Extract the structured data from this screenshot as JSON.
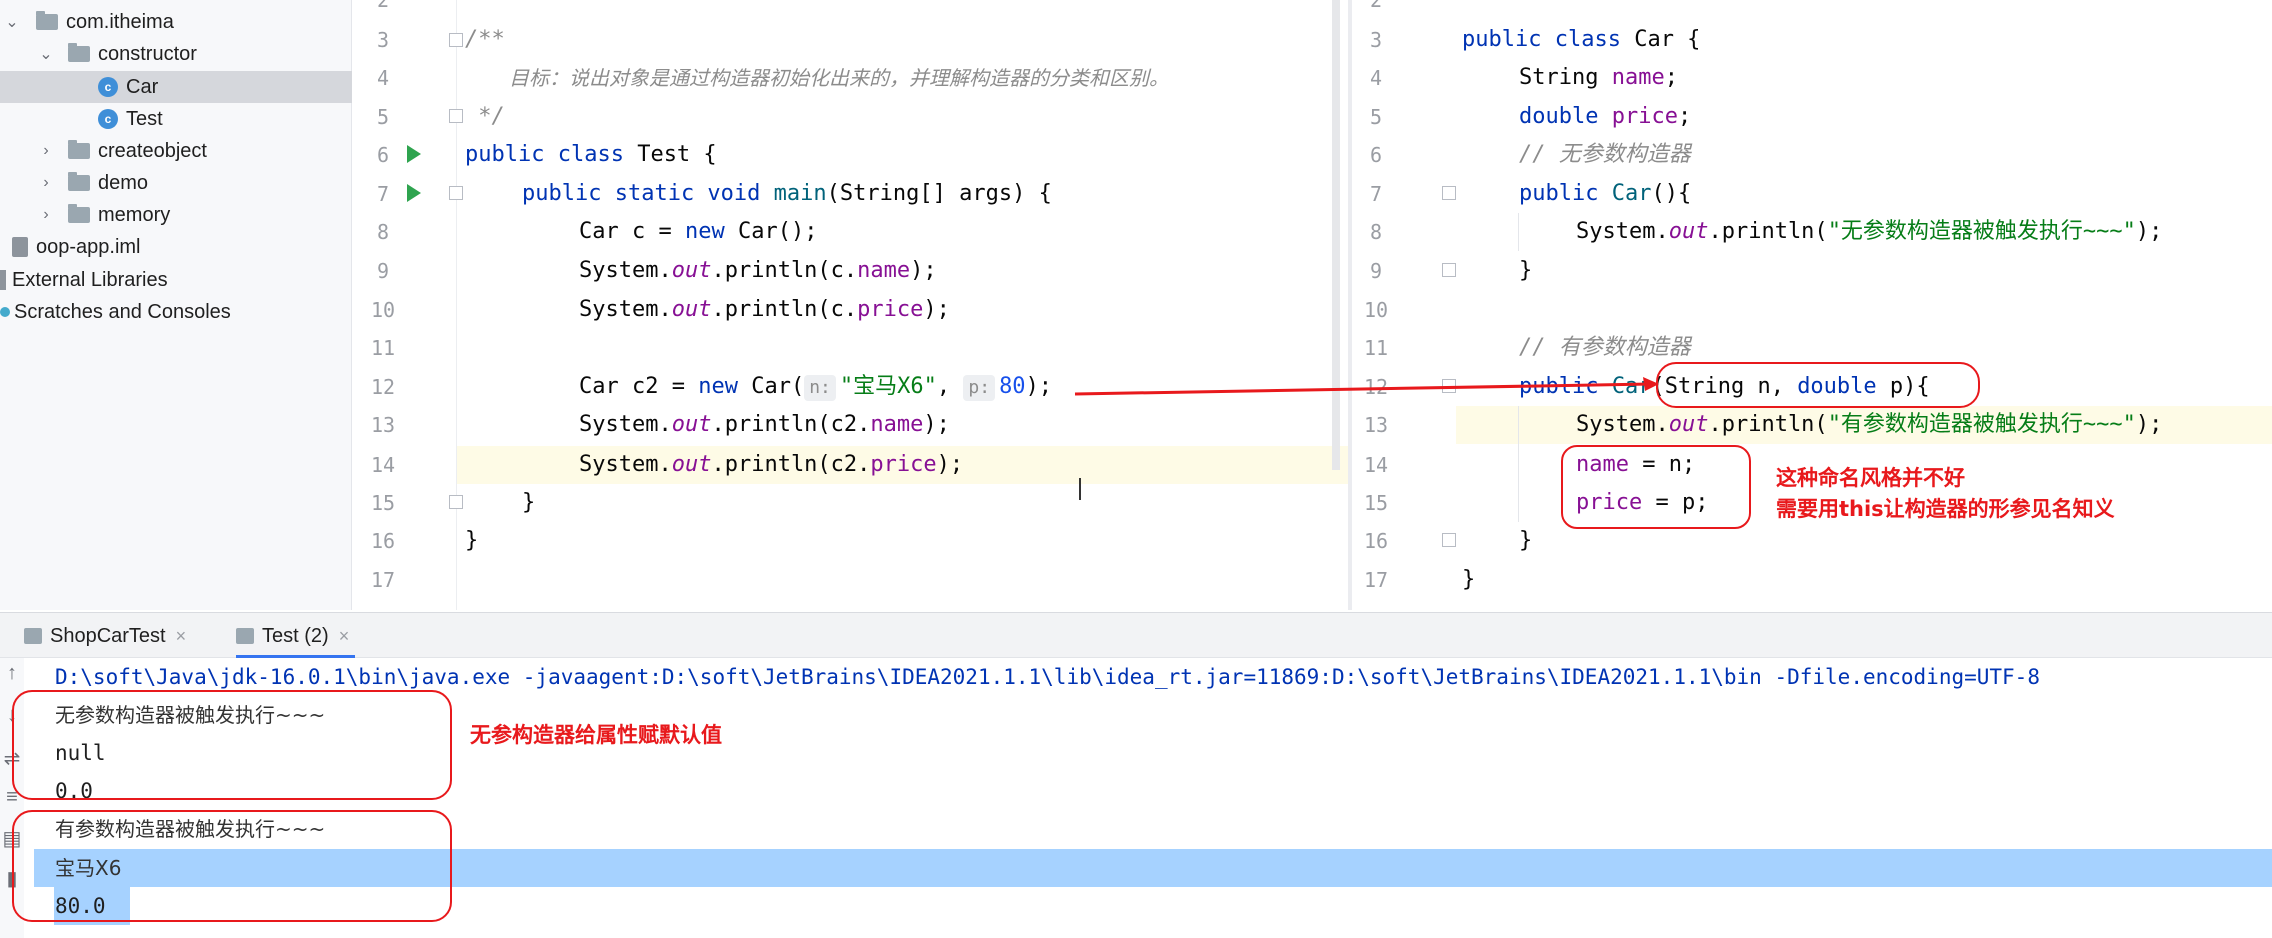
{
  "project_tree": {
    "items": [
      {
        "label": "com.itheima",
        "icon": "folder-icon",
        "chevron": "⌄"
      },
      {
        "label": "constructor",
        "icon": "folder-icon",
        "chevron": "⌄"
      },
      {
        "label": "Car",
        "icon": "class-icon"
      },
      {
        "label": "Test",
        "icon": "class-icon"
      },
      {
        "label": "createobject",
        "icon": "folder-icon",
        "chevron": "›"
      },
      {
        "label": "demo",
        "icon": "folder-icon",
        "chevron": "›"
      },
      {
        "label": "memory",
        "icon": "folder-icon",
        "chevron": "›"
      },
      {
        "label": "oop-app.iml",
        "icon": "iml-file-icon"
      },
      {
        "label": "External Libraries",
        "icon": "library-icon"
      },
      {
        "label": "Scratches and Consoles",
        "icon": "scratches-icon"
      }
    ]
  },
  "editor_left": {
    "line_numbers": [
      "2",
      "3",
      "4",
      "5",
      "6",
      "7",
      "8",
      "9",
      "10",
      "11",
      "12",
      "13",
      "14",
      "15",
      "16",
      "17"
    ],
    "lines": {
      "l3": "/**",
      "l4": "目标：说出对象是通过构造器初始化出来的，并理解构造器的分类和区别。",
      "l5": " */",
      "l6_kw": "public class",
      "l6_rest": " Test {",
      "l7_kw": "public static void",
      "l7_fn": "main",
      "l7_rest": "(String[] args) {",
      "l8_a": "Car c = ",
      "l8_kw": "new",
      "l8_b": " Car();",
      "l9_a": "System.",
      "l9_st": "out",
      "l9_b": ".println(c.",
      "l9_fld": "name",
      "l9_c": ");",
      "l10_a": "System.",
      "l10_st": "out",
      "l10_b": ".println(c.",
      "l10_fld": "price",
      "l10_c": ");",
      "l12_a": "Car c2 = ",
      "l12_kw": "new",
      "l12_b": " Car(",
      "l12_hint_n": "n:",
      "l12_str": "\"宝马X6\"",
      "l12_comma": ", ",
      "l12_hint_p": "p:",
      "l12_num": "80",
      "l12_c": ");",
      "l13_a": "System.",
      "l13_st": "out",
      "l13_b": ".println(c2.",
      "l13_fld": "name",
      "l13_c": ");",
      "l14_a": "System.",
      "l14_st": "out",
      "l14_b": ".println(c2.",
      "l14_fld": "price",
      "l14_c": ");",
      "l15": "}",
      "l16": "}"
    }
  },
  "editor_right": {
    "line_numbers": [
      "2",
      "3",
      "4",
      "5",
      "6",
      "7",
      "8",
      "9",
      "10",
      "11",
      "12",
      "13",
      "14",
      "15",
      "16",
      "17"
    ],
    "lines": {
      "l3_kw": "public class",
      "l3_rest": " Car {",
      "l4_a": "String ",
      "l4_fld": "name",
      "l4_b": ";",
      "l5_kw": "double",
      "l5_sp": " ",
      "l5_fld": "price",
      "l5_b": ";",
      "l6": "// 无参数构造器",
      "l7_kw": "public",
      "l7_sp": " ",
      "l7_fn": "Car",
      "l7_b": "(){",
      "l8_a": "System.",
      "l8_st": "out",
      "l8_b": ".println(",
      "l8_str": "\"无参数构造器被触发执行~~~\"",
      "l8_c": ");",
      "l9": "}",
      "l11": "// 有参数构造器",
      "l12_kw": "public",
      "l12_sp": " ",
      "l12_fn": "Car",
      "l12_b": "(String n, ",
      "l12_kw2": "double",
      "l12_c": " p){",
      "l13_a": "System.",
      "l13_st": "out",
      "l13_b": ".println(",
      "l13_str": "\"有参数构造器被触发执行~~~\"",
      "l13_c": ");",
      "l14_fld": "name",
      "l14_b": " = n;",
      "l15_fld": "price",
      "l15_b": " = p;",
      "l16": "}",
      "l17": "}"
    }
  },
  "annotations": {
    "naming_style_line1": "这种命名风格并不好",
    "naming_style_line2": "需要用this让构造器的形参见名知义",
    "default_values": "无参构造器给属性赋默认值"
  },
  "run_window": {
    "tabs": [
      {
        "label": "ShopCarTest",
        "close": "×"
      },
      {
        "label": "Test (2)",
        "close": "×"
      }
    ],
    "command": "D:\\soft\\Java\\jdk-16.0.1\\bin\\java.exe -javaagent:D:\\soft\\JetBrains\\IDEA2021.1.1\\lib\\idea_rt.jar=11869:D:\\soft\\JetBrains\\IDEA2021.1.1\\bin -Dfile.encoding=UTF-8",
    "output": [
      "无参数构造器被触发执行~~~",
      "null",
      "0.0",
      "有参数构造器被触发执行~~~",
      "宝马X6",
      "80.0"
    ]
  },
  "colors": {
    "annotation_red": "#e8191c",
    "selection_blue": "#a6d2ff",
    "keyword": "#0033b3",
    "field": "#871094",
    "string": "#067d17"
  }
}
